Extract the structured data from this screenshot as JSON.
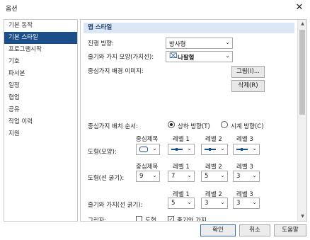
{
  "window": {
    "title": "옵션",
    "close_symbol": "✕"
  },
  "sidebar": {
    "items": [
      {
        "label": "기본 동작",
        "selected": false
      },
      {
        "label": "기본 스타일",
        "selected": true
      },
      {
        "label": "프로그램시작",
        "selected": false
      },
      {
        "label": "기호",
        "selected": false
      },
      {
        "label": "파서본",
        "selected": false
      },
      {
        "label": "일정",
        "selected": false
      },
      {
        "label": "협업",
        "selected": false
      },
      {
        "label": "공유",
        "selected": false
      },
      {
        "label": "작업 이력",
        "selected": false
      },
      {
        "label": "지원",
        "selected": false
      }
    ]
  },
  "panel": {
    "section_title": "맵 스타일",
    "direction": {
      "label": "진행 방향:",
      "value": "방사형"
    },
    "branch_shape": {
      "label": "줄기와 가지 모양(가지선):",
      "value": "나팔형"
    },
    "bg_image": {
      "label": "중심가지 배경 이미지:",
      "image_button": "그림(I)...",
      "delete_button": "삭제(R)"
    },
    "order": {
      "label": "중심가지 배치 순서:",
      "option1": "상하 방향(T)",
      "option2": "시계 방향(C)",
      "selected": "option1"
    },
    "shape_row": {
      "label": "도형(모양):",
      "headers": [
        "중심제목",
        "레벨 1",
        "레벨 2",
        "레벨 3"
      ]
    },
    "thickness_row": {
      "label": "도형(선 굵기):",
      "headers": [
        "중심제목",
        "레벨 1",
        "레벨 2",
        "레벨 3"
      ],
      "values": [
        "9",
        "7",
        "5",
        "3"
      ]
    },
    "branch_thickness_row": {
      "label": "줄기와 가지(선 굵기):",
      "headers": [
        "레벨 1",
        "레벨 2",
        "레벨 3"
      ],
      "values": [
        "5",
        "3",
        "3"
      ]
    },
    "shadow": {
      "label": "그림자:",
      "option1": "도형",
      "option2": "줄기와 가지",
      "checked1": false,
      "checked2": true
    }
  },
  "footer": {
    "ok": "확인",
    "cancel": "취소",
    "help": "도움말"
  },
  "colors": {
    "accent": "#1c4f8a",
    "section_bg": "#dbe7f4"
  }
}
